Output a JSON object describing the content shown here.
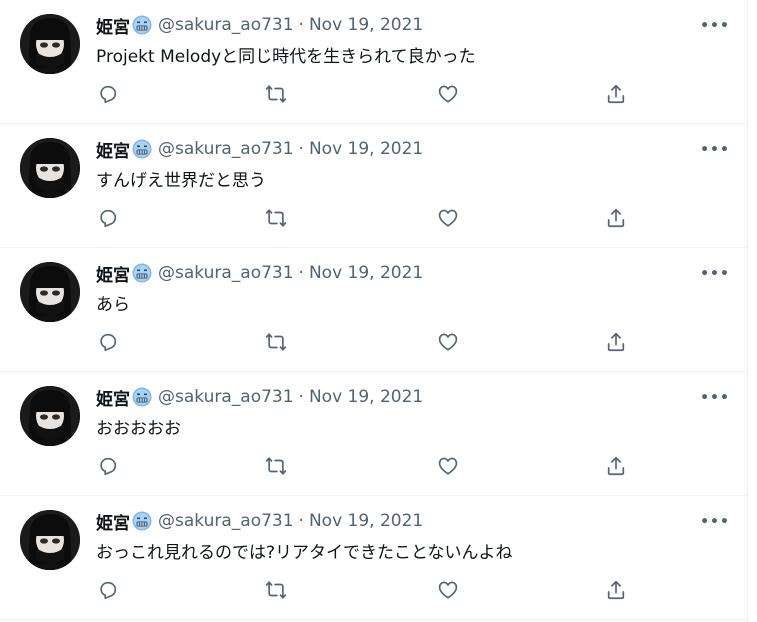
{
  "user": {
    "display_name": "姫宮",
    "handle": "@sakura_ao731",
    "badge_icon": "crying-face-emoji-icon"
  },
  "colors": {
    "text_primary": "#0f1419",
    "text_secondary": "#536471",
    "border": "#eff3f4",
    "badge_blue": "#1d9bf0"
  },
  "separator": "·",
  "more_label": "•••",
  "tweets": [
    {
      "date": "Nov 19, 2021",
      "text": "Projekt Melodyと同じ時代を生きられて良かった"
    },
    {
      "date": "Nov 19, 2021",
      "text": "すんげえ世界だと思う"
    },
    {
      "date": "Nov 19, 2021",
      "text": "あら"
    },
    {
      "date": "Nov 19, 2021",
      "text": "おおおおお"
    },
    {
      "date": "Nov 19, 2021",
      "text": "おっこれ見れるのでは?リアタイできたことないんよね"
    }
  ],
  "action_icons": [
    "reply-icon",
    "retweet-icon",
    "like-icon",
    "share-icon"
  ]
}
